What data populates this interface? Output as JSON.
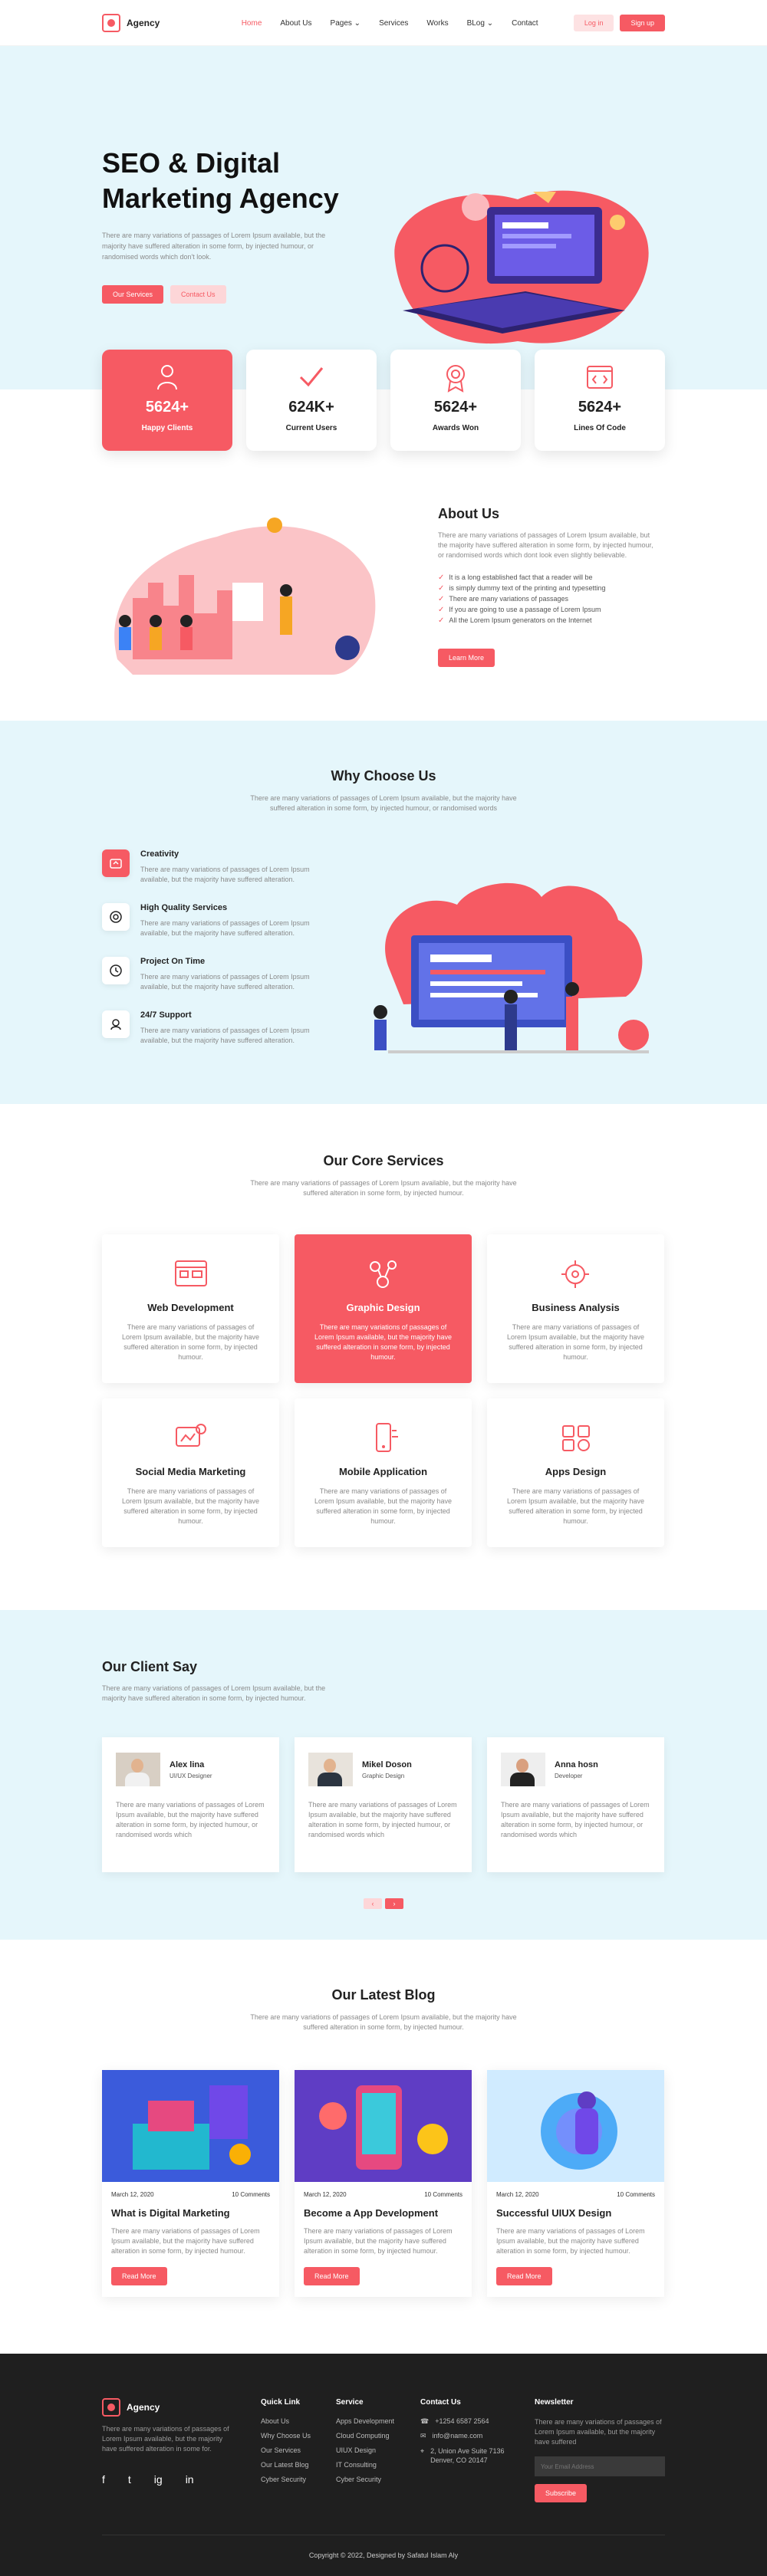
{
  "brand": {
    "name": "Agency",
    "accent": "#f65a63",
    "light_bg": "#e5f6fb"
  },
  "nav": {
    "items": [
      "Home",
      "About Us",
      "Pages",
      "Services",
      "Works",
      "BLog",
      "Contact"
    ],
    "login": "Log in",
    "signup": "Sign up"
  },
  "hero": {
    "title_line1": "SEO & Digital",
    "title_line2": "Marketing Agency",
    "subtitle": "There are many variations of passages of Lorem Ipsum available, but the majority have suffered alteration in some form, by injected humour, or randomised words which don't look.",
    "btn_services": "Our Services",
    "btn_contact": "Contact Us"
  },
  "stats": [
    {
      "value": "5624+",
      "label": "Happy Clients",
      "icon": "user-icon"
    },
    {
      "value": "624K+",
      "label": "Current Users",
      "icon": "check-icon"
    },
    {
      "value": "5624+",
      "label": "Awards Won",
      "icon": "award-icon"
    },
    {
      "value": "5624+",
      "label": "Lines Of Code",
      "icon": "code-icon"
    }
  ],
  "about": {
    "title": "About Us",
    "desc": "There are many variations of passages of Lorem Ipsum available, but the majority have suffered alteration in some form, by injected humour, or randomised words which dont look even slightly believable.",
    "points": [
      "It is a long established fact that a reader will be",
      "is simply dummy text of the printing and typesetting",
      "There are many variations of passages",
      "If you are going to use a passage of Lorem Ipsum",
      "All the Lorem Ipsum generators on the Internet"
    ],
    "button": "Learn More"
  },
  "why": {
    "title": "Why Choose Us",
    "desc": "There are many variations of passages of Lorem Ipsum available, but the majority have suffered alteration in some form, by injected humour, or randomised words",
    "features": [
      {
        "title": "Creativity",
        "text": "There are many variations of passages of Lorem Ipsum available, but the majority have suffered alteration."
      },
      {
        "title": "High Quality Services",
        "text": "There are many variations of passages of Lorem Ipsum available, but the majority have suffered alteration."
      },
      {
        "title": "Project On Time",
        "text": "There are many variations of passages of Lorem Ipsum available, but the majority have suffered alteration."
      },
      {
        "title": "24/7 Support",
        "text": "There are many variations of passages of Lorem Ipsum available, but the majority have suffered alteration."
      }
    ]
  },
  "services": {
    "title": "Our Core Services",
    "desc": "There are many variations of passages of Lorem Ipsum available, but the majority have suffered alteration in some form, by injected humour.",
    "items": [
      {
        "title": "Web Development",
        "text": "There are many variations of passages of Lorem Ipsum available, but the majority have suffered alteration in some form, by injected humour."
      },
      {
        "title": "Graphic Design",
        "text": "There are many variations of passages of Lorem Ipsum available, but the majority have suffered alteration in some form, by injected humour."
      },
      {
        "title": "Business Analysis",
        "text": "There are many variations of passages of Lorem Ipsum available, but the majority have suffered alteration in some form, by injected humour."
      },
      {
        "title": "Social Media Marketing",
        "text": "There are many variations of passages of Lorem Ipsum available, but the majority have suffered alteration in some form, by injected humour."
      },
      {
        "title": "Mobile Application",
        "text": "There are many variations of passages of Lorem Ipsum available, but the majority have suffered alteration in some form, by injected humour."
      },
      {
        "title": "Apps Design",
        "text": "There are many variations of passages of Lorem Ipsum available, but the majority have suffered alteration in some form, by injected humour."
      }
    ]
  },
  "clients": {
    "title": "Our Client Say",
    "desc": "There are many variations of passages of Lorem Ipsum available, but the majority have suffered alteration in some form, by injected humour.",
    "items": [
      {
        "name": "Alex lina",
        "role": "UI/UX Designer",
        "text": "There are many variations of passages of Lorem Ipsum available, but the majority have suffered alteration in some form, by injected humour, or randomised words which"
      },
      {
        "name": "Mikel Doson",
        "role": "Graphic Design",
        "text": "There are many variations of passages of Lorem Ipsum available, but the majority have suffered alteration in some form, by injected humour, or randomised words which"
      },
      {
        "name": "Anna hosn",
        "role": "Developer",
        "text": "There are many variations of passages of Lorem Ipsum available, but the majority have suffered alteration in some form, by injected humour, or randomised words which"
      }
    ],
    "prev": "‹",
    "next": "›"
  },
  "blog": {
    "title": "Our Latest Blog",
    "desc": "There are many variations of passages of Lorem Ipsum available, but the majority have suffered alteration in some form, by injected humour.",
    "posts": [
      {
        "date": "March 12, 2020",
        "comments": "10 Comments",
        "title": "What is Digital Marketing",
        "text": "There are many variations of passages of Lorem Ipsum available, but the majority have suffered alteration in some form, by injected humour.",
        "button": "Read More"
      },
      {
        "date": "March 12, 2020",
        "comments": "10 Comments",
        "title": "Become a App Development",
        "text": "There are many variations of passages of Lorem Ipsum available, but the majority have suffered alteration in some form, by injected humour.",
        "button": "Read More"
      },
      {
        "date": "March 12, 2020",
        "comments": "10 Comments",
        "title": "Successful UIUX Design",
        "text": "There are many variations of passages of Lorem Ipsum available, but the majority have suffered alteration in some form, by injected humour.",
        "button": "Read More"
      }
    ]
  },
  "footer": {
    "about": "There are many variations of passages of Lorem Ipsum available, but the majority have suffered alteration in some for.",
    "social": [
      "f",
      "t",
      "ig",
      "in"
    ],
    "quick_title": "Quick Link",
    "quick": [
      "About Us",
      "Why Choose Us",
      "Our Services",
      "Our Latest Blog",
      "Cyber Security"
    ],
    "service_title": "Service",
    "service": [
      "Apps Development",
      "Cloud Computing",
      "UIUX Design",
      "IT Consulting",
      "Cyber Security"
    ],
    "contact_title": "Contact Us",
    "contact": [
      "+1254 6587 2564",
      "info@name.com",
      "2, Union Ave Suite 7136 Denver, CO 20147"
    ],
    "news_title": "Newsletter",
    "news_desc": "There are many variations of passages of Lorem Ipsum available, but the majority have suffered",
    "news_placeholder": "Your Email Address",
    "news_btn": "Subscribe",
    "copyright": "Copyright  ©  2022, Designed by Safatul Islam Aly"
  }
}
